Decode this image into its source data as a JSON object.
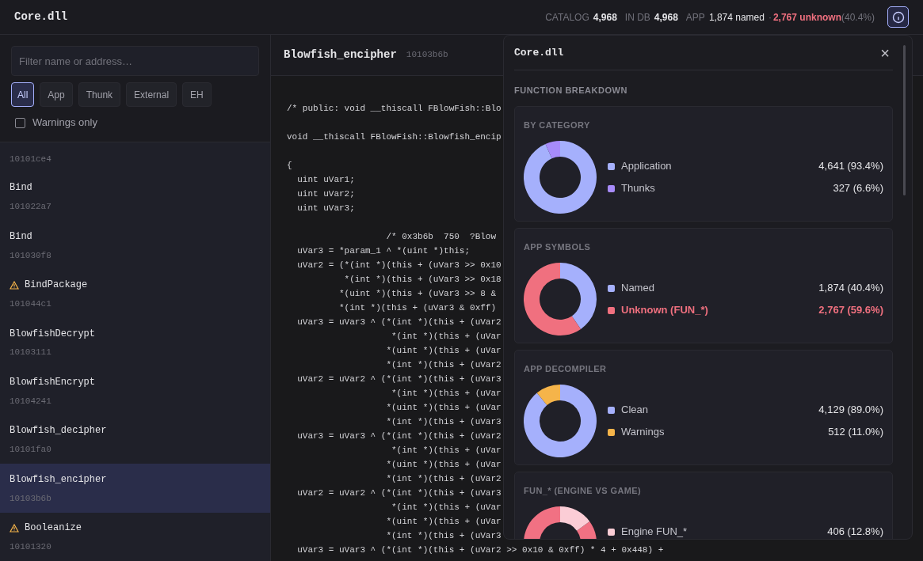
{
  "app": {
    "title": "Core.dll",
    "stats": [
      {
        "label": "CATALOG",
        "value": "4,968"
      },
      {
        "label": "IN DB",
        "value": "4,968"
      }
    ],
    "app_stat": {
      "label": "APP",
      "named": "1,874 named",
      "separator": "·",
      "unknown": "2,767 unknown",
      "percent": "(40.4%)"
    }
  },
  "sidebar": {
    "filter": {
      "placeholder": "Filter name or address…"
    },
    "chips": [
      {
        "label": "All",
        "selected": true
      },
      {
        "label": "App",
        "selected": false
      },
      {
        "label": "Thunk",
        "selected": false
      },
      {
        "label": "External",
        "selected": false
      },
      {
        "label": "EH",
        "selected": false
      }
    ],
    "warnings_only": {
      "label": "Warnings only",
      "checked": false
    },
    "items": [
      {
        "address": "10101ce4",
        "warning": false,
        "selected": false
      },
      {
        "name": "Bind",
        "address": "101022a7",
        "warning": false,
        "selected": false
      },
      {
        "name": "Bind",
        "address": "101030f8",
        "warning": false,
        "selected": false
      },
      {
        "name": "BindPackage",
        "address": "101044c1",
        "warning": true,
        "selected": false
      },
      {
        "name": "BlowfishDecrypt",
        "address": "10103111",
        "warning": false,
        "selected": false
      },
      {
        "name": "BlowfishEncrypt",
        "address": "10104241",
        "warning": false,
        "selected": false
      },
      {
        "name": "Blowfish_decipher",
        "address": "10101fa0",
        "warning": false,
        "selected": false
      },
      {
        "name": "Blowfish_encipher",
        "address": "10103b6b",
        "warning": false,
        "selected": true
      },
      {
        "name": "Booleanize",
        "address": "10101320",
        "warning": true,
        "selected": false
      }
    ]
  },
  "code": {
    "function": "Blowfish_encipher",
    "address": "10103b6b",
    "blocks": [
      [
        "/* public: void __thiscall FBlowFish::Blo"
      ],
      [
        "void __thiscall FBlowFish::Blowfish_encip"
      ],
      [
        "{",
        "  uint uVar1;",
        "  uint uVar2;",
        "  uint uVar3;"
      ],
      [
        "                   /* 0x3b6b  750  ?Blow",
        "  uVar3 = *param_1 ^ *(uint *)this;",
        "  uVar2 = (*(int *)(this + (uVar3 >> 0x10",
        "           *(int *)(this + (uVar3 >> 0x18",
        "          *(uint *)(this + (uVar3 >> 8 &",
        "          *(int *)(this + (uVar3 & 0xff)",
        "  uVar3 = uVar3 ^ (*(int *)(this + (uVar2",
        "                    *(int *)(this + (uVar",
        "                   *(uint *)(this + (uVar",
        "                   *(int *)(this + (uVar2",
        "  uVar2 = uVar2 ^ (*(int *)(this + (uVar3",
        "                    *(int *)(this + (uVar",
        "                   *(uint *)(this + (uVar",
        "                   *(int *)(this + (uVar3",
        "  uVar3 = uVar3 ^ (*(int *)(this + (uVar2",
        "                    *(int *)(this + (uVar",
        "                   *(uint *)(this + (uVar",
        "                   *(int *)(this + (uVar2",
        "  uVar2 = uVar2 ^ (*(int *)(this + (uVar3",
        "                    *(int *)(this + (uVar",
        "                   *(uint *)(this + (uVar",
        "                   *(int *)(this + (uVar3",
        "  uVar3 = uVar3 ^ (*(int *)(this + (uVar2 >> 0x10 & 0xff) * 4 + 0x448) +"
      ]
    ]
  },
  "popover": {
    "title": "Core.dll",
    "close": "×",
    "section": "FUNCTION BREAKDOWN",
    "cards": [
      {
        "title": "BY CATEGORY",
        "items": [
          {
            "value": "4,641 (93.4%)",
            "color": "#a5b0fc",
            "highlight": false
          },
          {
            "value": "327 (6.6%)",
            "color": "#a78bfa",
            "highlight": false
          }
        ],
        "chart_data": {
          "type": "donut",
          "categories": [
            "Application",
            "Thunks"
          ],
          "values": [
            93.4,
            6.6
          ]
        }
      },
      {
        "title": "APP SYMBOLS",
        "items": [
          {
            "value": "1,874 (40.4%)",
            "color": "#a5b0fc",
            "highlight": false
          },
          {
            "value": "2,767 (59.6%)",
            "color": "#f0707f",
            "highlight": true
          }
        ],
        "chart_data": {
          "type": "donut",
          "categories": [
            "Named",
            "Unknown (FUN_*)"
          ],
          "values": [
            40.4,
            59.6
          ]
        }
      },
      {
        "title": "APP DECOMPILER",
        "items": [
          {
            "value": "4,129 (89.0%)",
            "color": "#a5b0fc",
            "highlight": false
          },
          {
            "value": "512 (11.0%)",
            "color": "#f5b44a",
            "highlight": false
          }
        ],
        "chart_data": {
          "type": "donut",
          "categories": [
            "Clean",
            "Warnings"
          ],
          "values": [
            89.0,
            11.0
          ]
        }
      },
      {
        "title": "FUN_* (ENGINE VS GAME)",
        "items": [
          {
            "label": "Engine FUN_*",
            "value": "406 (12.8%)",
            "color": "#fbcdd6",
            "highlight": false
          }
        ]
      }
    ]
  }
}
